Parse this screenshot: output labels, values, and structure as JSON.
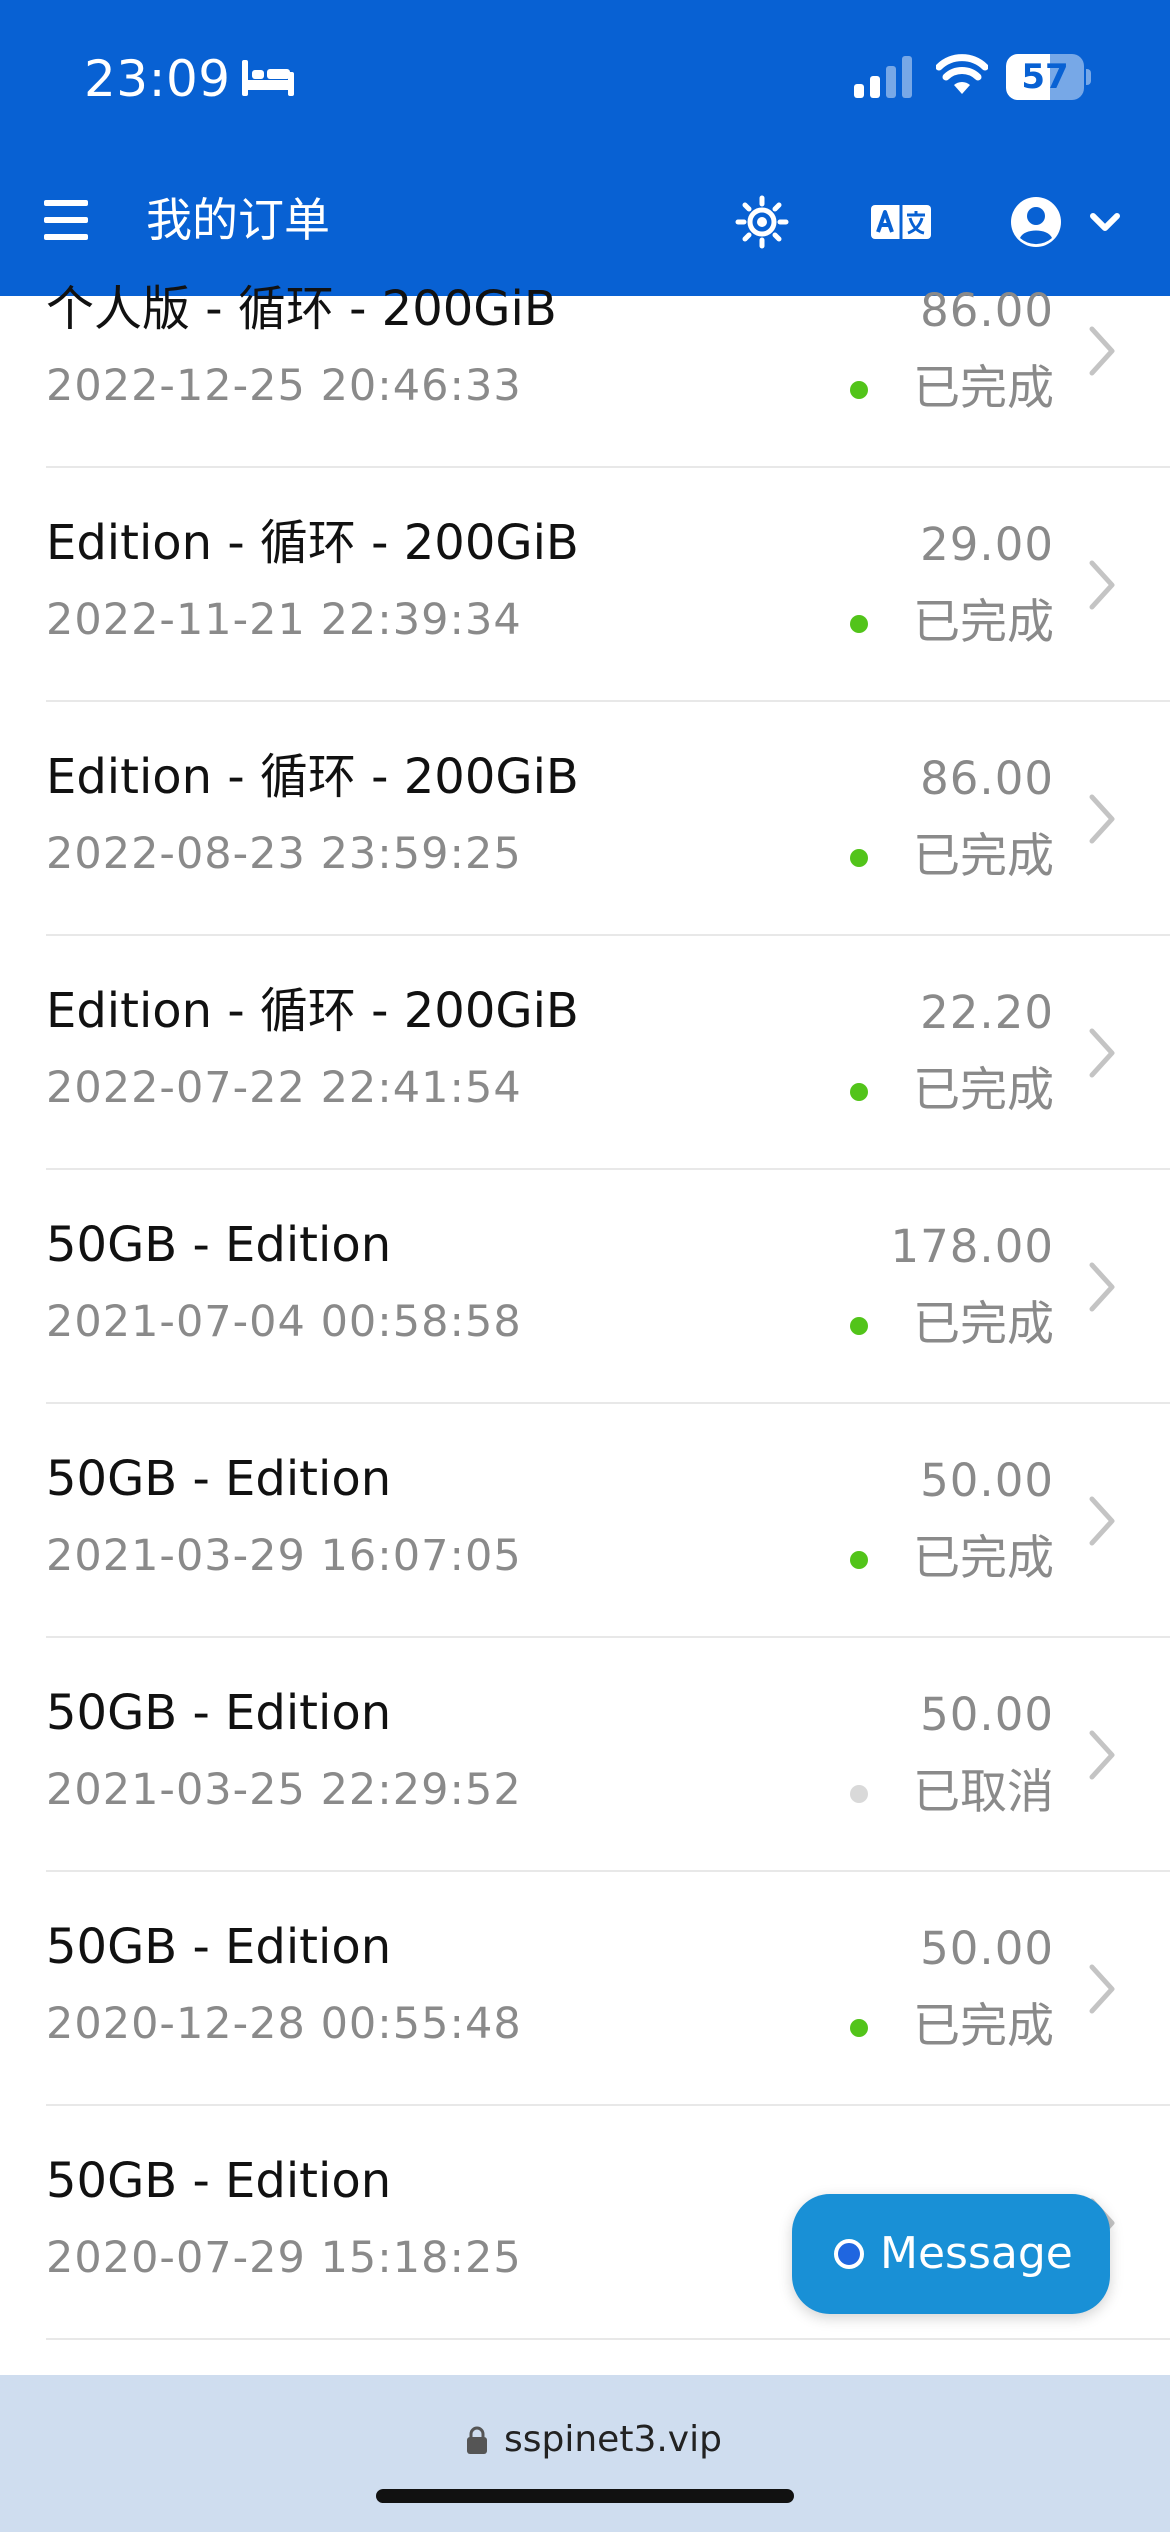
{
  "status_bar": {
    "time": "23:09",
    "battery": "57",
    "battery_level": 0.57
  },
  "header": {
    "title": "我的订单"
  },
  "colors": {
    "header_bg": "#0861d3",
    "status_done": "#52c41a",
    "status_cancelled": "#d9d9d9",
    "message_button": "#1990d6",
    "urlbar_bg": "#cfddef"
  },
  "orders": [
    {
      "name": "个人版 - 循环 - 200GiB",
      "date": "2022-12-25 20:46:33",
      "price": "86.00",
      "status": "已完成",
      "state": "done"
    },
    {
      "name": "Edition - 循环 - 200GiB",
      "date": "2022-11-21 22:39:34",
      "price": "29.00",
      "status": "已完成",
      "state": "done"
    },
    {
      "name": "Edition - 循环 - 200GiB",
      "date": "2022-08-23 23:59:25",
      "price": "86.00",
      "status": "已完成",
      "state": "done"
    },
    {
      "name": "Edition - 循环 - 200GiB",
      "date": "2022-07-22 22:41:54",
      "price": "22.20",
      "status": "已完成",
      "state": "done"
    },
    {
      "name": "50GB - Edition",
      "date": "2021-07-04 00:58:58",
      "price": "178.00",
      "status": "已完成",
      "state": "done"
    },
    {
      "name": "50GB - Edition",
      "date": "2021-03-29 16:07:05",
      "price": "50.00",
      "status": "已完成",
      "state": "done"
    },
    {
      "name": "50GB - Edition",
      "date": "2021-03-25 22:29:52",
      "price": "50.00",
      "status": "已取消",
      "state": "cancelled"
    },
    {
      "name": "50GB - Edition",
      "date": "2020-12-28 00:55:48",
      "price": "50.00",
      "status": "已完成",
      "state": "done"
    },
    {
      "name": "50GB - Edition",
      "date": "2020-07-29 15:18:25",
      "price": "",
      "status": "",
      "state": "hidden"
    }
  ],
  "message_button": {
    "label": "Message"
  },
  "urlbar": {
    "url": "sspinet3.vip"
  },
  "icons": {
    "menu": "menu-icon",
    "theme": "sun-icon",
    "language": "translate-icon",
    "account": "user-icon",
    "row_arrow": "chevron-right-icon"
  }
}
